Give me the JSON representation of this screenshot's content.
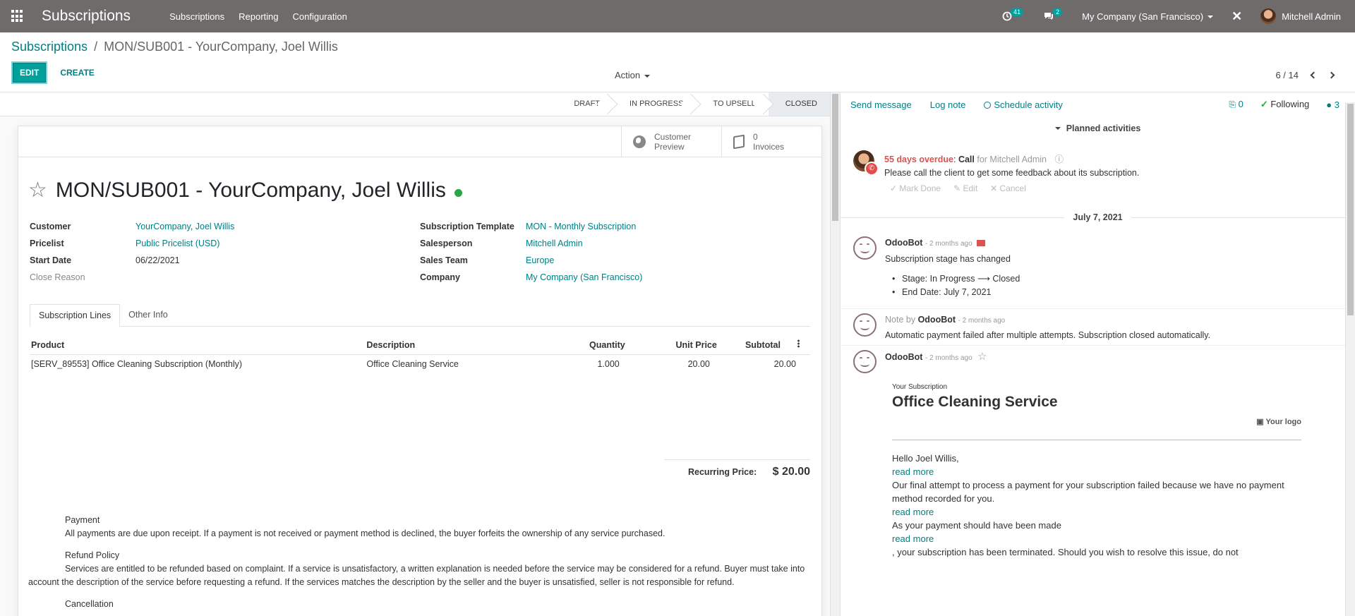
{
  "navbar": {
    "brand": "Subscriptions",
    "menu": [
      "Subscriptions",
      "Reporting",
      "Configuration"
    ],
    "activity_count": "41",
    "message_count": "2",
    "company": "My Company (San Francisco)",
    "user": "Mitchell Admin"
  },
  "control_panel": {
    "breadcrumb_root": "Subscriptions",
    "breadcrumb_sep": "/",
    "breadcrumb_current": "MON/SUB001 - YourCompany, Joel Willis",
    "edit_label": "EDIT",
    "create_label": "CREATE",
    "action_label": "Action",
    "pager": "6 / 14"
  },
  "statusbar": {
    "stages": [
      "DRAFT",
      "IN PROGRESS",
      "TO UPSELL",
      "CLOSED"
    ],
    "active_stage": "CLOSED"
  },
  "button_box": {
    "preview_line1": "Customer",
    "preview_line2": "Preview",
    "invoices_count": "0",
    "invoices_label": "Invoices"
  },
  "record": {
    "title": "MON/SUB001 - YourCompany, Joel Willis",
    "status_color": "#28a745",
    "left_fields": [
      {
        "label": "Customer",
        "value": "YourCompany, Joel Willis",
        "link": true
      },
      {
        "label": "Pricelist",
        "value": "Public Pricelist (USD)",
        "link": true
      },
      {
        "label": "Start Date",
        "value": "06/22/2021",
        "link": false
      },
      {
        "label": "Close Reason",
        "value": "",
        "link": false
      }
    ],
    "right_fields": [
      {
        "label": "Subscription Template",
        "value": "MON - Monthly Subscription",
        "link": true
      },
      {
        "label": "Salesperson",
        "value": "Mitchell Admin",
        "link": true
      },
      {
        "label": "Sales Team",
        "value": "Europe",
        "link": true
      },
      {
        "label": "Company",
        "value": "My Company (San Francisco)",
        "link": true
      }
    ]
  },
  "tabs": [
    "Subscription Lines",
    "Other Info"
  ],
  "lines": {
    "headers": [
      "Product",
      "Description",
      "Quantity",
      "Unit Price",
      "Subtotal"
    ],
    "rows": [
      [
        "[SERV_89553] Office Cleaning Subscription (Monthly)",
        "Office Cleaning Service",
        "1.000",
        "20.00",
        "20.00"
      ]
    ]
  },
  "recurring": {
    "label": "Recurring Price:",
    "value": "$ 20.00"
  },
  "terms": {
    "payment_title": "Payment",
    "payment_text": "All payments are due upon receipt. If a payment is not received or payment method is declined, the buyer forfeits the ownership of any service purchased.",
    "refund_title": "Refund Policy",
    "refund_text": "Services are entitled to be refunded based on complaint. If a service is unsatisfactory, a written explanation is needed before the service may be considered for a refund. Buyer must take into account the description of the service before requesting a refund. If the services matches the description by the seller and the buyer is unsatisfied, seller is not responsible for refund.",
    "cancel_title": "Cancellation"
  },
  "chatter": {
    "send_message": "Send message",
    "log_note": "Log note",
    "schedule_activity": "Schedule activity",
    "attachments": "0",
    "following": "Following",
    "followers": "3",
    "planned_title": "Planned activities",
    "activity": {
      "overdue": "55 days overdue",
      "colon": ":",
      "type": "Call",
      "for_text": "for Mitchell Admin",
      "note": "Please call the client to get some feedback about its subscription.",
      "mark_done": "Mark Done",
      "edit": "Edit",
      "cancel": "Cancel"
    },
    "date_sep": "July 7, 2021",
    "messages": [
      {
        "author": "OdooBot",
        "time": "- 2 months ago",
        "text": "Subscription stage has changed",
        "bullets": [
          "Stage: In Progress ⟶ Closed",
          "End Date: July 7, 2021"
        ]
      },
      {
        "prefix": "Note by",
        "author": "OdooBot",
        "time": "- 2 months ago",
        "text": "Automatic payment failed after multiple attempts. Subscription closed automatically."
      },
      {
        "author": "OdooBot",
        "time": "- 2 months ago"
      }
    ],
    "email": {
      "eyebrow": "Your Subscription",
      "title": "Office Cleaning Service",
      "logo": "Your logo",
      "greeting": "Hello Joel Willis,",
      "read_more": "read more",
      "p1": "Our final attempt to process a payment for your subscription failed because we have no payment method recorded for you.",
      "p2": "As your payment should have been made",
      "p3": ", your subscription has been terminated. Should you wish to resolve this issue, do not"
    }
  }
}
